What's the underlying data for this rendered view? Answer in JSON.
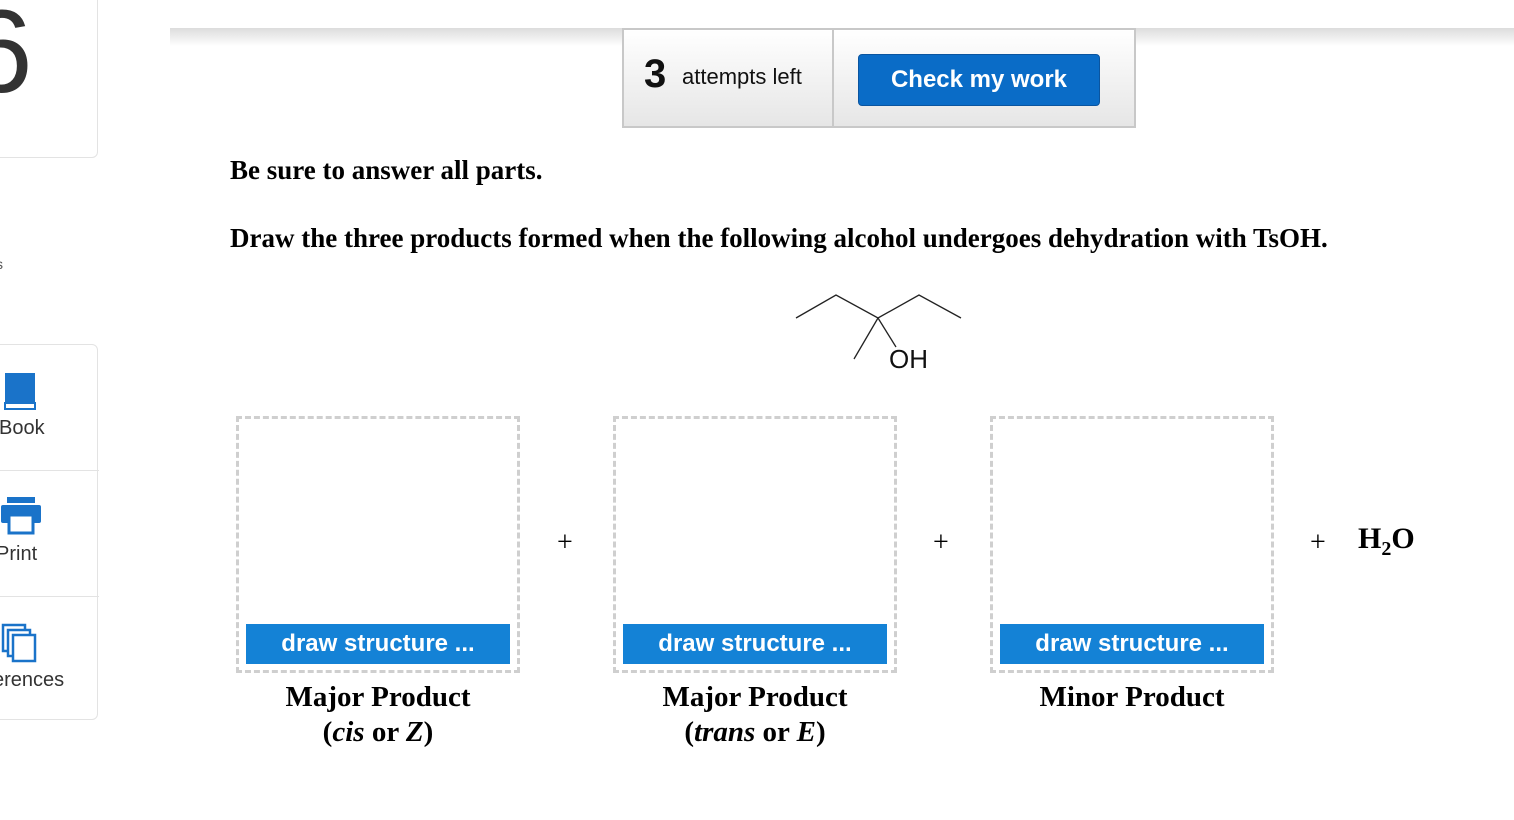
{
  "rail": {
    "question_number": "6",
    "partial_label": "s",
    "tools": [
      {
        "label": "Book",
        "icon": "book-icon"
      },
      {
        "label": "Print",
        "icon": "printer-icon"
      },
      {
        "label": "erences",
        "icon": "references-icon"
      }
    ]
  },
  "header": {
    "attempts_count": "3",
    "attempts_text": "attempts left",
    "check_button": "Check my work"
  },
  "question": {
    "instruction": "Be sure to answer all parts.",
    "prompt": "Draw the three products formed when the following alcohol undergoes dehydration with TsOH.",
    "oh_label": "OH"
  },
  "answers": {
    "draw_button": "draw structure ...",
    "plus": "+",
    "water_h": "H",
    "water_sub": "2",
    "water_o": "O",
    "products": [
      {
        "line1": "Major Product",
        "open": "(",
        "stereo": "cis",
        "or": " or ",
        "config": "Z",
        "close": ")"
      },
      {
        "line1": "Major Product",
        "open": "(",
        "stereo": "trans",
        "or": " or ",
        "config": "E",
        "close": ")"
      },
      {
        "line1": "Minor Product"
      }
    ]
  },
  "colors": {
    "button_blue": "#0a6cc7",
    "draw_button_blue": "#1482d6",
    "icon_blue": "#1a73c9"
  }
}
